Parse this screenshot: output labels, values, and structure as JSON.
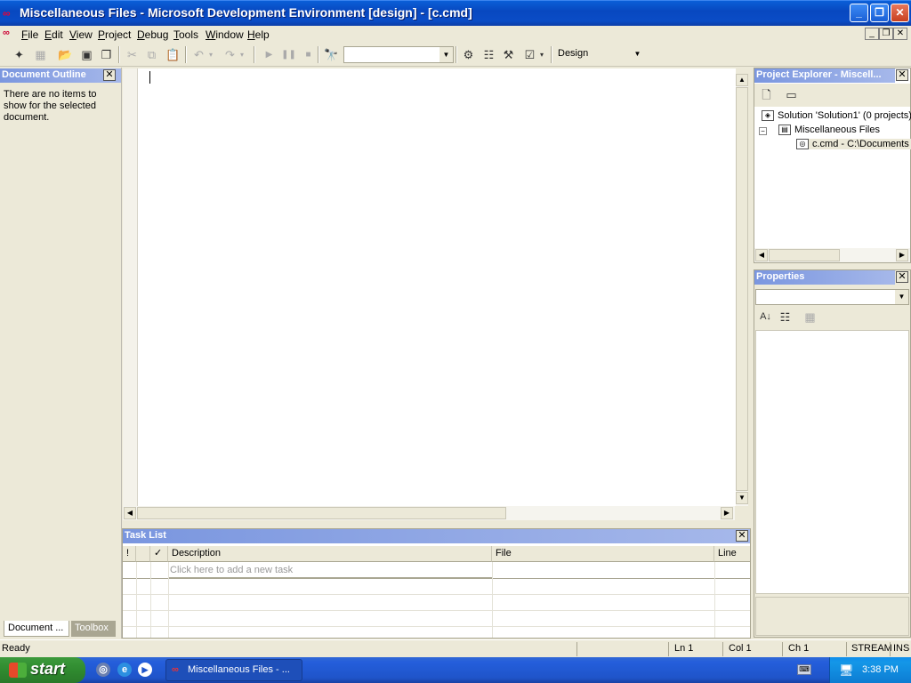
{
  "window": {
    "title": "Miscellaneous Files - Microsoft Development Environment [design] - [c.cmd]",
    "controls": {
      "minimize": "_",
      "maximize": "❐",
      "close": "✕"
    }
  },
  "menu": {
    "items": [
      "File",
      "Edit",
      "View",
      "Project",
      "Debug",
      "Tools",
      "Window",
      "Help"
    ]
  },
  "toolbar": {
    "find_combo_value": "",
    "config_combo_value": "Design"
  },
  "document_outline": {
    "title": "Document Outline",
    "message": "There are no items to show for the selected document."
  },
  "left_tabs": [
    "Document ...",
    "Toolbox"
  ],
  "editor": {
    "content": ""
  },
  "task_list": {
    "title": "Task List",
    "columns": [
      "!",
      "",
      "✓",
      "Description",
      "File",
      "Line"
    ],
    "placeholder_row": "Click here to add a new task"
  },
  "project_explorer": {
    "title": "Project Explorer - Miscell...",
    "tree": [
      "Solution 'Solution1' (0 projects)",
      "Miscellaneous Files",
      "c.cmd - C:\\Documents"
    ]
  },
  "properties": {
    "title": "Properties",
    "object_combo_value": ""
  },
  "statusbar": {
    "status": "Ready",
    "ln": "Ln 1",
    "col": "Col 1",
    "ch": "Ch 1",
    "mode": "STREAM",
    "ins": "INS"
  },
  "taskbar": {
    "start_label": "start",
    "active_app": "Miscellaneous Files - ...",
    "clock": "3:38 PM"
  },
  "icons": [
    "app-logo-icon",
    "new-project-icon",
    "add-item-icon",
    "open-icon",
    "save-icon",
    "save-all-icon",
    "cut-icon",
    "copy-icon",
    "paste-icon",
    "undo-icon",
    "redo-icon",
    "start-debug-icon",
    "break-icon",
    "stop-icon",
    "find-icon",
    "solution-explorer-icon",
    "properties-icon",
    "toolbox-icon",
    "task-list-icon"
  ]
}
